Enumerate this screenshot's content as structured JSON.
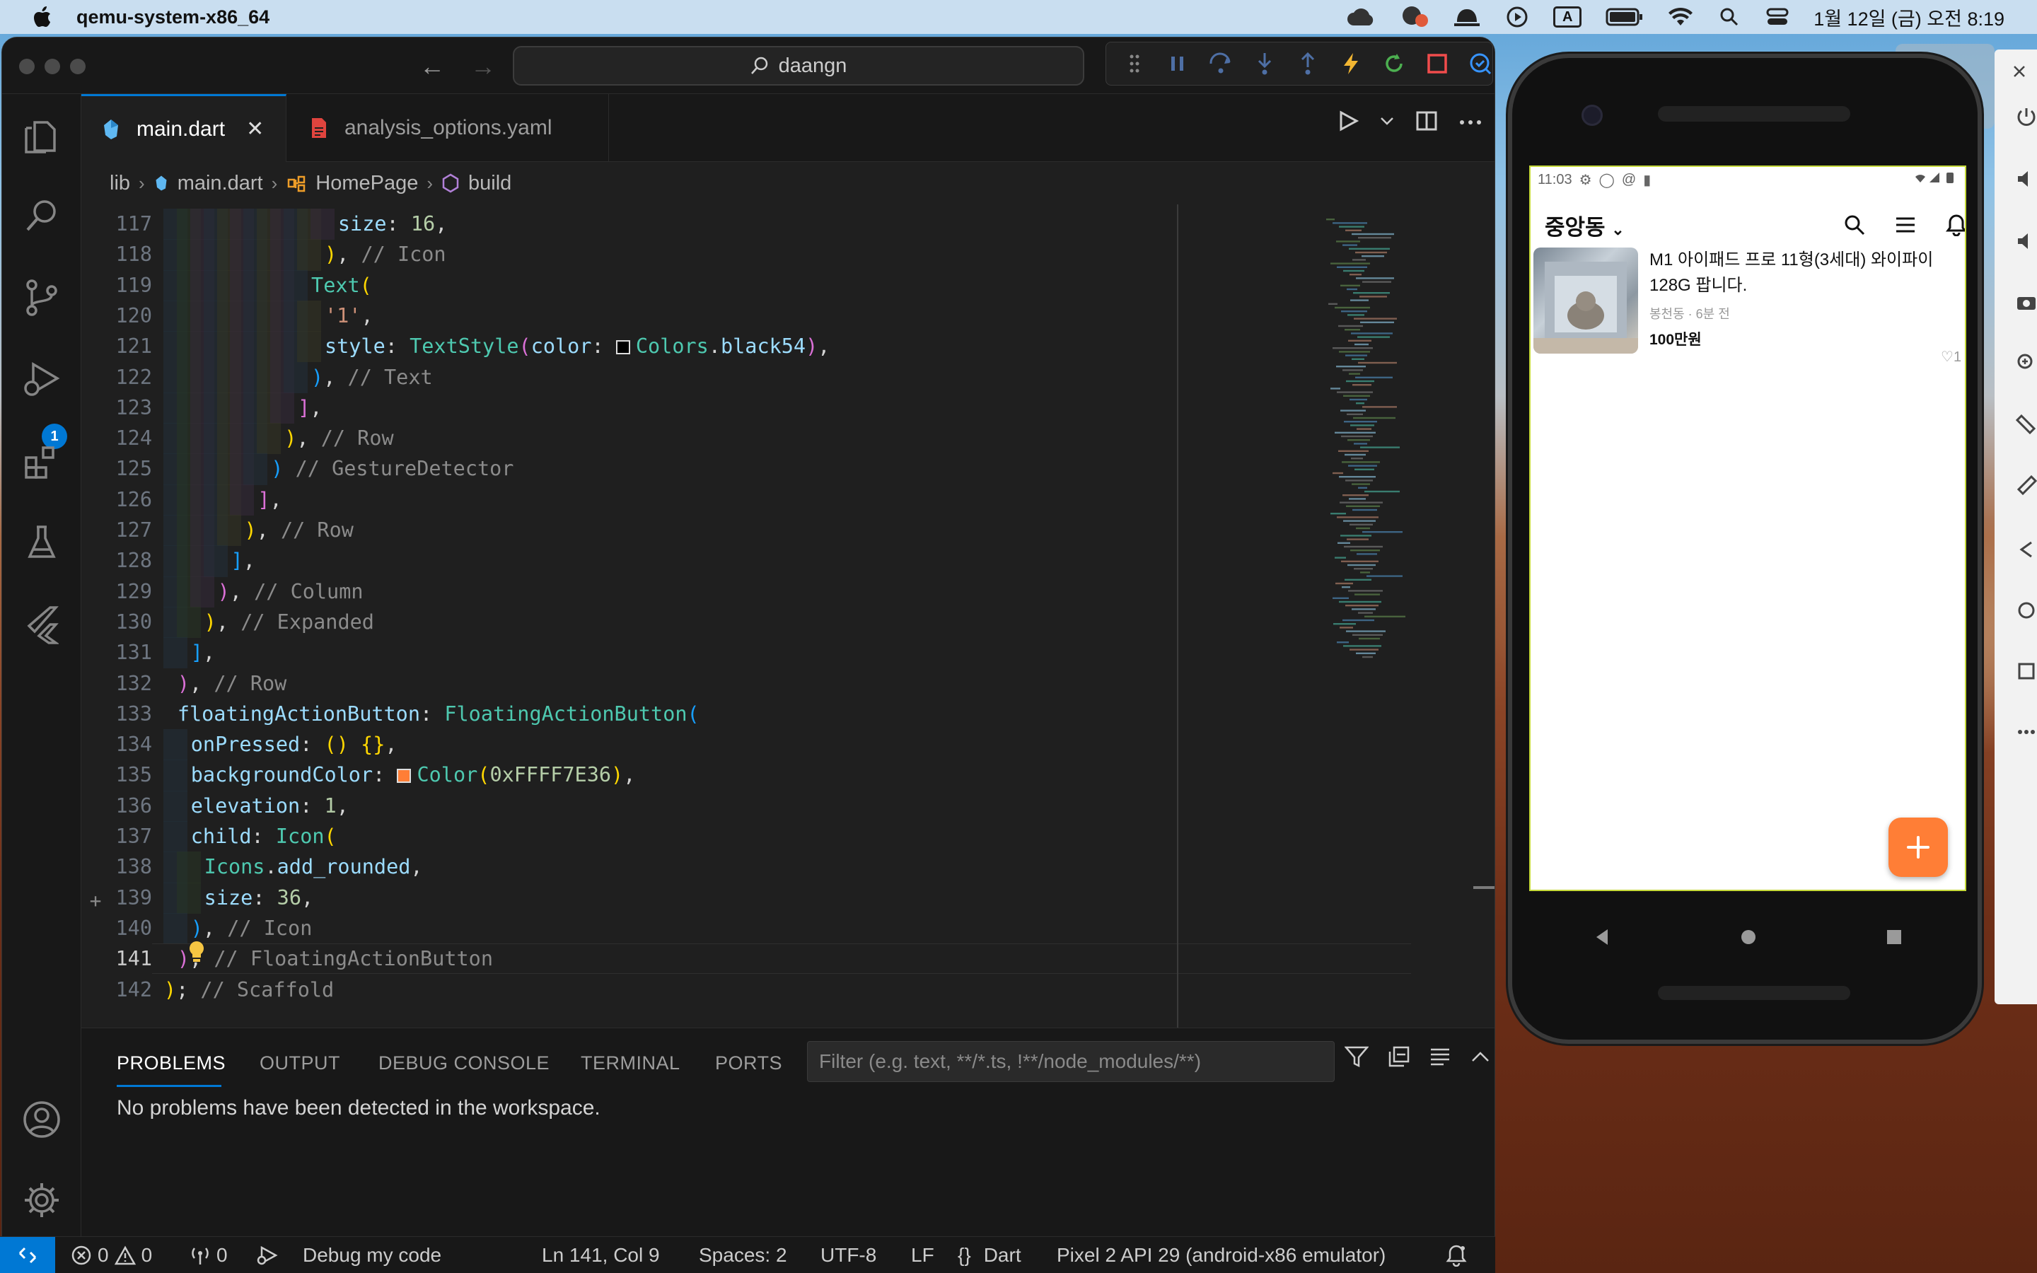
{
  "menubar": {
    "app_name": "qemu-system-x86_64",
    "input_indicator": "A",
    "clock": "1월 12일 (금) 오전 8:19"
  },
  "window": {
    "search_text": "daangn"
  },
  "activity": {
    "debug_badge": "1"
  },
  "tabs": [
    {
      "label": "main.dart",
      "active": true
    },
    {
      "label": "analysis_options.yaml",
      "active": false
    }
  ],
  "breadcrumb": [
    "lib",
    "main.dart",
    "HomePage",
    "build"
  ],
  "editor": {
    "lines": [
      {
        "num": "117",
        "text": "size: 16,"
      },
      {
        "num": "118",
        "text": "), // Icon"
      },
      {
        "num": "119",
        "text": "Text("
      },
      {
        "num": "120",
        "text": "'1',"
      },
      {
        "num": "121",
        "text": "style: TextStyle(color: Colors.black54),"
      },
      {
        "num": "122",
        "text": "), // Text"
      },
      {
        "num": "123",
        "text": "],"
      },
      {
        "num": "124",
        "text": "), // Row"
      },
      {
        "num": "125",
        "text": ") // GestureDetector"
      },
      {
        "num": "126",
        "text": "],"
      },
      {
        "num": "127",
        "text": "), // Row"
      },
      {
        "num": "128",
        "text": "],"
      },
      {
        "num": "129",
        "text": "), // Column"
      },
      {
        "num": "130",
        "text": "), // Expanded"
      },
      {
        "num": "131",
        "text": "],"
      },
      {
        "num": "132",
        "text": "), // Row"
      },
      {
        "num": "133",
        "text": "floatingActionButton: FloatingActionButton("
      },
      {
        "num": "134",
        "text": "onPressed: () {},"
      },
      {
        "num": "135",
        "text": "backgroundColor: Color(0xFFFF7E36),"
      },
      {
        "num": "136",
        "text": "elevation: 1,"
      },
      {
        "num": "137",
        "text": "child: Icon("
      },
      {
        "num": "138",
        "text": "Icons.add_rounded,"
      },
      {
        "num": "139",
        "text": "size: 36,"
      },
      {
        "num": "140",
        "text": "), // Icon"
      },
      {
        "num": "141",
        "text": "), // FloatingActionButton"
      },
      {
        "num": "142",
        "text": "); // Scaffold"
      }
    ]
  },
  "panel": {
    "tabs": [
      "PROBLEMS",
      "OUTPUT",
      "DEBUG CONSOLE",
      "TERMINAL",
      "PORTS"
    ],
    "filter_placeholder": "Filter (e.g. text, **/*.ts, !**/node_modules/**)",
    "message": "No problems have been detected in the workspace."
  },
  "statusbar": {
    "errors": "0",
    "warnings": "0",
    "ports": "0",
    "debug_label": "Debug my code",
    "position": "Ln 141, Col 9",
    "spaces": "Spaces: 2",
    "encoding": "UTF-8",
    "eol": "LF",
    "language": "Dart",
    "device": "Pixel 2 API 29 (android-x86 emulator)"
  },
  "emulator": {
    "time": "11:03",
    "location": "중앙동",
    "product": {
      "title": "M1 아이패드 프로 11형(3세대) 와이파이 128G 팝니다.",
      "meta": "봉천동 · 6분 전",
      "price": "100만원",
      "likes": "1"
    }
  },
  "colors": {
    "accent": "#0078d4",
    "fab": "#ff7e36",
    "editor_bg": "#1f1f1f",
    "chrome_bg": "#181818"
  }
}
